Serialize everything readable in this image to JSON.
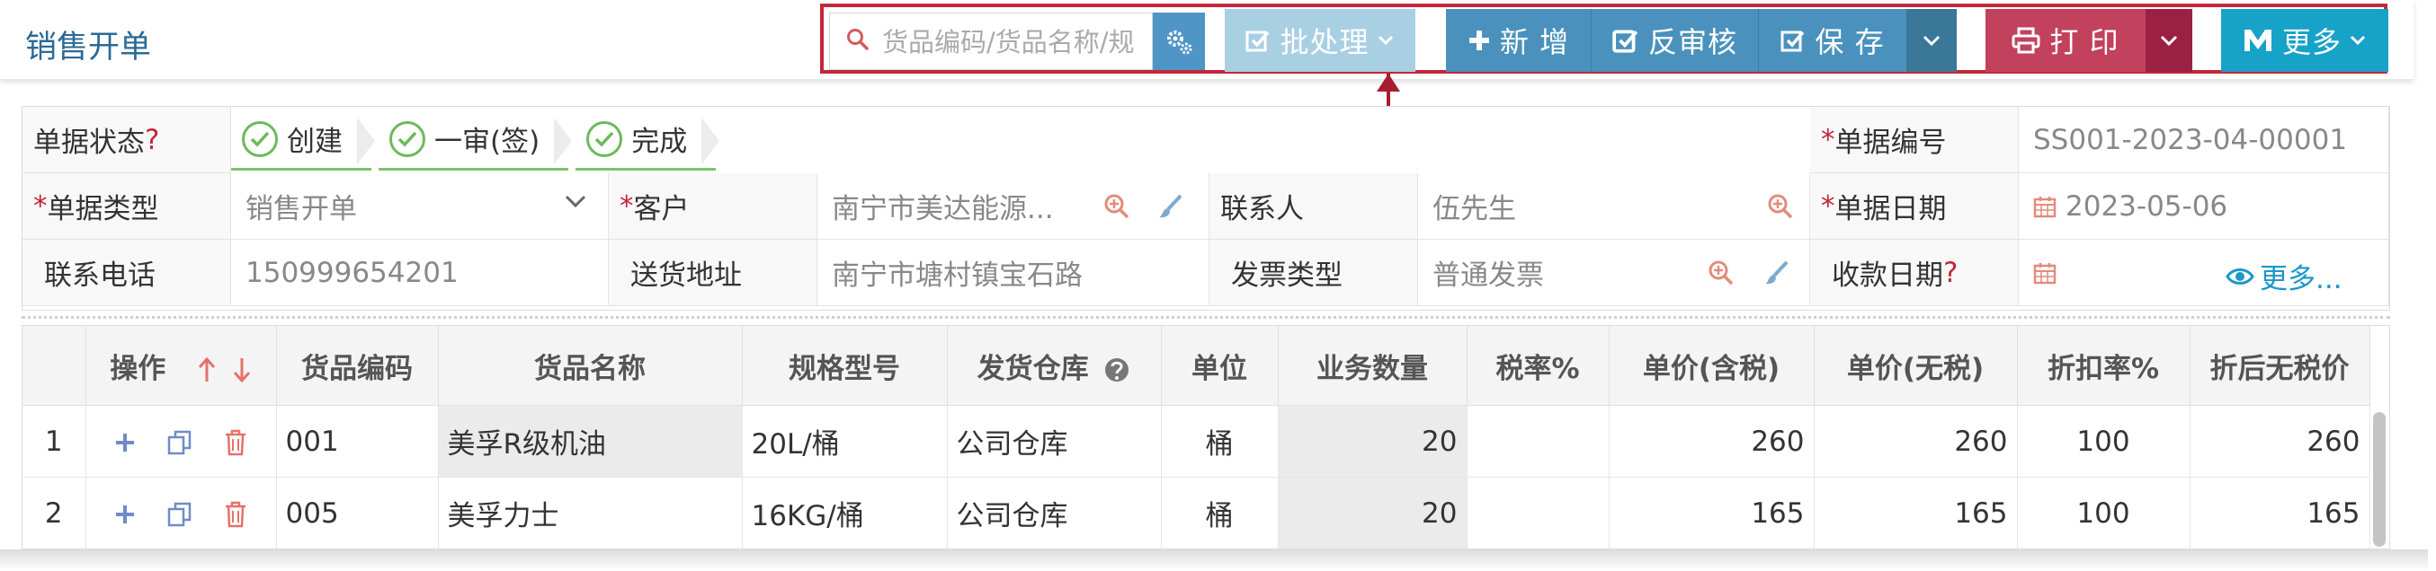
{
  "page": {
    "title": "销售开单"
  },
  "toolbar": {
    "search_placeholder": "货品编码/货品名称/规",
    "batch_label": "批处理",
    "new_label": "新 增",
    "unaudit_label": "反审核",
    "save_label": "保 存",
    "print_label": "打 印",
    "more_label": "更多"
  },
  "form": {
    "status_label": "单据状态",
    "status_q": "?",
    "stages": [
      "创建",
      "一审(签)",
      "完成"
    ],
    "doc_no_label": "单据编号",
    "doc_no": "SS001-2023-04-00001",
    "doc_type_label": "单据类型",
    "doc_type": "销售开单",
    "customer_label": "客户",
    "customer": "南宁市美达能源...",
    "contact_label": "联系人",
    "contact": "伍先生",
    "doc_date_label": "单据日期",
    "doc_date": "2023-05-06",
    "phone_label": "联系电话",
    "phone": "150999654201",
    "address_label": "送货地址",
    "address": "南宁市塘村镇宝石路",
    "invoice_label": "发票类型",
    "invoice": "普通发票",
    "pay_date_label": "收款日期",
    "pay_date_q": "?",
    "pay_date": "",
    "more_link": "更多..."
  },
  "table": {
    "headers": [
      "",
      "操作",
      "货品编码",
      "货品名称",
      "规格型号",
      "发货仓库",
      "单位",
      "业务数量",
      "税率%",
      "单价(含税)",
      "单价(无税)",
      "折扣率%",
      "折后无税价"
    ],
    "rows": [
      {
        "idx": "1",
        "code": "001",
        "name": "美孚R级机油",
        "spec": "20L/桶",
        "warehouse": "公司仓库",
        "unit": "桶",
        "qty": "20",
        "tax": "",
        "price_tax": "260",
        "price_notax": "260",
        "discount": "100",
        "after_price": "260"
      },
      {
        "idx": "2",
        "code": "005",
        "name": "美孚力士",
        "spec": "16KG/桶",
        "warehouse": "公司仓库",
        "unit": "桶",
        "qty": "20",
        "tax": "",
        "price_tax": "165",
        "price_notax": "165",
        "discount": "100",
        "after_price": "165"
      }
    ]
  },
  "colors": {
    "accent": "#4a92bd",
    "danger": "#c2415d",
    "highlight": "#c4263a",
    "more": "#17a2c8",
    "success": "#6cba5a"
  }
}
